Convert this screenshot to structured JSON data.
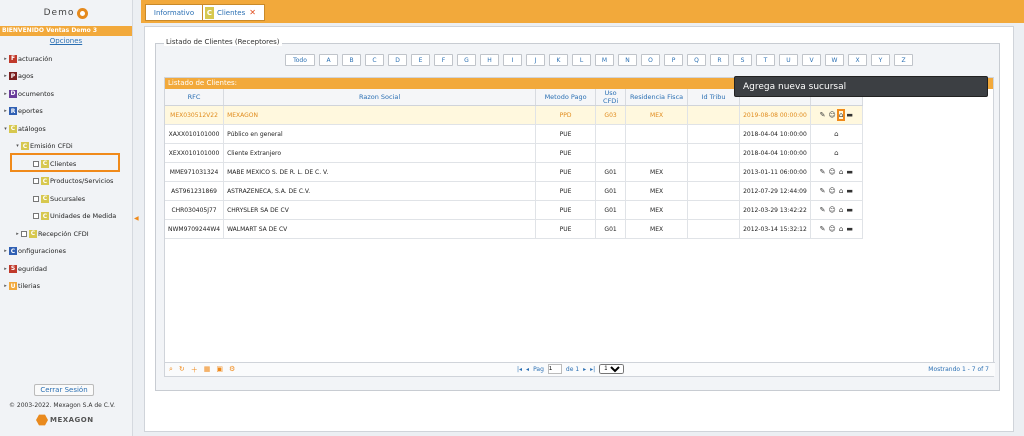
{
  "sidebar": {
    "logo_text": "Demo",
    "welcome": "BIENVENIDO Ventas Demo 3",
    "options": "Opciones",
    "menu": [
      {
        "first": "F",
        "rest": "acturación",
        "color": "#c0392b"
      },
      {
        "first": "P",
        "rest": "agos",
        "color": "#7a1f1f"
      },
      {
        "first": "D",
        "rest": "ocumentos",
        "color": "#6a3d9a"
      },
      {
        "first": "R",
        "rest": "eportes",
        "color": "#2f5fb3"
      },
      {
        "first": "C",
        "rest": "atálogos",
        "color": "#d7c84f"
      }
    ],
    "emision": {
      "first": "C",
      "rest": "Emisión CFDi"
    },
    "items": [
      {
        "first": "C",
        "rest": "Clientes"
      },
      {
        "first": "C",
        "rest": "Productos/Servicios"
      },
      {
        "first": "C",
        "rest": "Sucursales"
      },
      {
        "first": "C",
        "rest": "Unidades de Medida"
      }
    ],
    "recepcion": {
      "first": "C",
      "rest": "Recepción CFDI"
    },
    "bottom_menu": [
      {
        "first": "C",
        "rest": "onfiguraciones",
        "color": "#2f5fb3"
      },
      {
        "first": "S",
        "rest": "eguridad",
        "color": "#c0392b"
      },
      {
        "first": "U",
        "rest": "tilerias",
        "color": "#f2a93b"
      }
    ],
    "logout": "Cerrar Sesión",
    "copyright": "© 2003-2022. Mexagon S.A de C.V.",
    "brand": "MEXAGON"
  },
  "tabs": {
    "info": "Informativo",
    "clientes_icon": "C",
    "clientes": "Clientes",
    "close": "✕"
  },
  "panel": {
    "legend": "Listado de Clientes (Receptores)",
    "letters": [
      "Todo",
      "A",
      "B",
      "C",
      "D",
      "E",
      "F",
      "G",
      "H",
      "I",
      "J",
      "K",
      "L",
      "M",
      "N",
      "O",
      "P",
      "Q",
      "R",
      "S",
      "T",
      "U",
      "V",
      "W",
      "X",
      "Y",
      "Z"
    ],
    "grid_caption": "Listado de Clientes:",
    "columns": [
      "RFC",
      "Razon Social",
      "Metodo Pago",
      "Uso CFDi",
      "Residencia Fisca",
      "Id Tribu",
      "",
      ""
    ],
    "rows": [
      {
        "rfc": "MEX030512V22",
        "razon": "MEXAGON",
        "metodo": "PPD",
        "uso": "G03",
        "residencia": "MEX",
        "idtrib": "",
        "fecha": "2019-08-08 00:00:00",
        "acts": "full"
      },
      {
        "rfc": "XAXX010101000",
        "razon": "Público en general",
        "metodo": "PUE",
        "uso": "",
        "residencia": "",
        "idtrib": "",
        "fecha": "2018-04-04 10:00:00",
        "acts": "one"
      },
      {
        "rfc": "XEXX010101000",
        "razon": "Cliente Extranjero",
        "metodo": "PUE",
        "uso": "",
        "residencia": "",
        "idtrib": "",
        "fecha": "2018-04-04 10:00:00",
        "acts": "one"
      },
      {
        "rfc": "MME971031324",
        "razon": "MABE MEXICO S. DE R. L. DE C. V.",
        "metodo": "PUE",
        "uso": "G01",
        "residencia": "MEX",
        "idtrib": "",
        "fecha": "2013-01-11 06:00:00",
        "acts": "full"
      },
      {
        "rfc": "AST961231869",
        "razon": "ASTRAZENECA, S.A. DE C.V.",
        "metodo": "PUE",
        "uso": "G01",
        "residencia": "MEX",
        "idtrib": "",
        "fecha": "2012-07-29 12:44:09",
        "acts": "full"
      },
      {
        "rfc": "CHR030405J77",
        "razon": "CHRYSLER SA DE CV",
        "metodo": "PUE",
        "uso": "G01",
        "residencia": "MEX",
        "idtrib": "",
        "fecha": "2012-03-29 13:42:22",
        "acts": "full"
      },
      {
        "rfc": "NWM9709244W4",
        "razon": "WALMART SA DE CV",
        "metodo": "PUE",
        "uso": "G01",
        "residencia": "MEX",
        "idtrib": "",
        "fecha": "2012-03-14 15:32:12",
        "acts": "full"
      }
    ],
    "tooltip": "Agrega nueva sucursal",
    "pager": {
      "page_label": "Pag",
      "page": "1",
      "of": "de 1",
      "per_page": "15",
      "info": "Mostrando 1 - 7 of 7"
    }
  },
  "colors": {
    "accent": "#f2a93b",
    "highlight": "#f08a1a",
    "link": "#2a6fb3"
  }
}
